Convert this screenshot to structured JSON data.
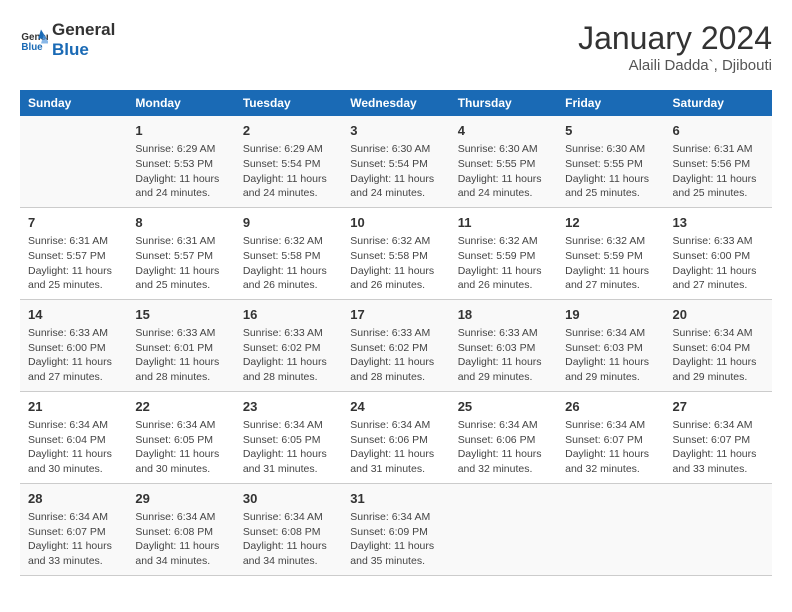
{
  "logo": {
    "line1": "General",
    "line2": "Blue"
  },
  "title": "January 2024",
  "location": "Alaili Dadda`, Djibouti",
  "weekdays": [
    "Sunday",
    "Monday",
    "Tuesday",
    "Wednesday",
    "Thursday",
    "Friday",
    "Saturday"
  ],
  "weeks": [
    [
      {
        "day": "",
        "info": ""
      },
      {
        "day": "1",
        "info": "Sunrise: 6:29 AM\nSunset: 5:53 PM\nDaylight: 11 hours\nand 24 minutes."
      },
      {
        "day": "2",
        "info": "Sunrise: 6:29 AM\nSunset: 5:54 PM\nDaylight: 11 hours\nand 24 minutes."
      },
      {
        "day": "3",
        "info": "Sunrise: 6:30 AM\nSunset: 5:54 PM\nDaylight: 11 hours\nand 24 minutes."
      },
      {
        "day": "4",
        "info": "Sunrise: 6:30 AM\nSunset: 5:55 PM\nDaylight: 11 hours\nand 24 minutes."
      },
      {
        "day": "5",
        "info": "Sunrise: 6:30 AM\nSunset: 5:55 PM\nDaylight: 11 hours\nand 25 minutes."
      },
      {
        "day": "6",
        "info": "Sunrise: 6:31 AM\nSunset: 5:56 PM\nDaylight: 11 hours\nand 25 minutes."
      }
    ],
    [
      {
        "day": "7",
        "info": "Sunrise: 6:31 AM\nSunset: 5:57 PM\nDaylight: 11 hours\nand 25 minutes."
      },
      {
        "day": "8",
        "info": "Sunrise: 6:31 AM\nSunset: 5:57 PM\nDaylight: 11 hours\nand 25 minutes."
      },
      {
        "day": "9",
        "info": "Sunrise: 6:32 AM\nSunset: 5:58 PM\nDaylight: 11 hours\nand 26 minutes."
      },
      {
        "day": "10",
        "info": "Sunrise: 6:32 AM\nSunset: 5:58 PM\nDaylight: 11 hours\nand 26 minutes."
      },
      {
        "day": "11",
        "info": "Sunrise: 6:32 AM\nSunset: 5:59 PM\nDaylight: 11 hours\nand 26 minutes."
      },
      {
        "day": "12",
        "info": "Sunrise: 6:32 AM\nSunset: 5:59 PM\nDaylight: 11 hours\nand 27 minutes."
      },
      {
        "day": "13",
        "info": "Sunrise: 6:33 AM\nSunset: 6:00 PM\nDaylight: 11 hours\nand 27 minutes."
      }
    ],
    [
      {
        "day": "14",
        "info": "Sunrise: 6:33 AM\nSunset: 6:00 PM\nDaylight: 11 hours\nand 27 minutes."
      },
      {
        "day": "15",
        "info": "Sunrise: 6:33 AM\nSunset: 6:01 PM\nDaylight: 11 hours\nand 28 minutes."
      },
      {
        "day": "16",
        "info": "Sunrise: 6:33 AM\nSunset: 6:02 PM\nDaylight: 11 hours\nand 28 minutes."
      },
      {
        "day": "17",
        "info": "Sunrise: 6:33 AM\nSunset: 6:02 PM\nDaylight: 11 hours\nand 28 minutes."
      },
      {
        "day": "18",
        "info": "Sunrise: 6:33 AM\nSunset: 6:03 PM\nDaylight: 11 hours\nand 29 minutes."
      },
      {
        "day": "19",
        "info": "Sunrise: 6:34 AM\nSunset: 6:03 PM\nDaylight: 11 hours\nand 29 minutes."
      },
      {
        "day": "20",
        "info": "Sunrise: 6:34 AM\nSunset: 6:04 PM\nDaylight: 11 hours\nand 29 minutes."
      }
    ],
    [
      {
        "day": "21",
        "info": "Sunrise: 6:34 AM\nSunset: 6:04 PM\nDaylight: 11 hours\nand 30 minutes."
      },
      {
        "day": "22",
        "info": "Sunrise: 6:34 AM\nSunset: 6:05 PM\nDaylight: 11 hours\nand 30 minutes."
      },
      {
        "day": "23",
        "info": "Sunrise: 6:34 AM\nSunset: 6:05 PM\nDaylight: 11 hours\nand 31 minutes."
      },
      {
        "day": "24",
        "info": "Sunrise: 6:34 AM\nSunset: 6:06 PM\nDaylight: 11 hours\nand 31 minutes."
      },
      {
        "day": "25",
        "info": "Sunrise: 6:34 AM\nSunset: 6:06 PM\nDaylight: 11 hours\nand 32 minutes."
      },
      {
        "day": "26",
        "info": "Sunrise: 6:34 AM\nSunset: 6:07 PM\nDaylight: 11 hours\nand 32 minutes."
      },
      {
        "day": "27",
        "info": "Sunrise: 6:34 AM\nSunset: 6:07 PM\nDaylight: 11 hours\nand 33 minutes."
      }
    ],
    [
      {
        "day": "28",
        "info": "Sunrise: 6:34 AM\nSunset: 6:07 PM\nDaylight: 11 hours\nand 33 minutes."
      },
      {
        "day": "29",
        "info": "Sunrise: 6:34 AM\nSunset: 6:08 PM\nDaylight: 11 hours\nand 34 minutes."
      },
      {
        "day": "30",
        "info": "Sunrise: 6:34 AM\nSunset: 6:08 PM\nDaylight: 11 hours\nand 34 minutes."
      },
      {
        "day": "31",
        "info": "Sunrise: 6:34 AM\nSunset: 6:09 PM\nDaylight: 11 hours\nand 35 minutes."
      },
      {
        "day": "",
        "info": ""
      },
      {
        "day": "",
        "info": ""
      },
      {
        "day": "",
        "info": ""
      }
    ]
  ]
}
